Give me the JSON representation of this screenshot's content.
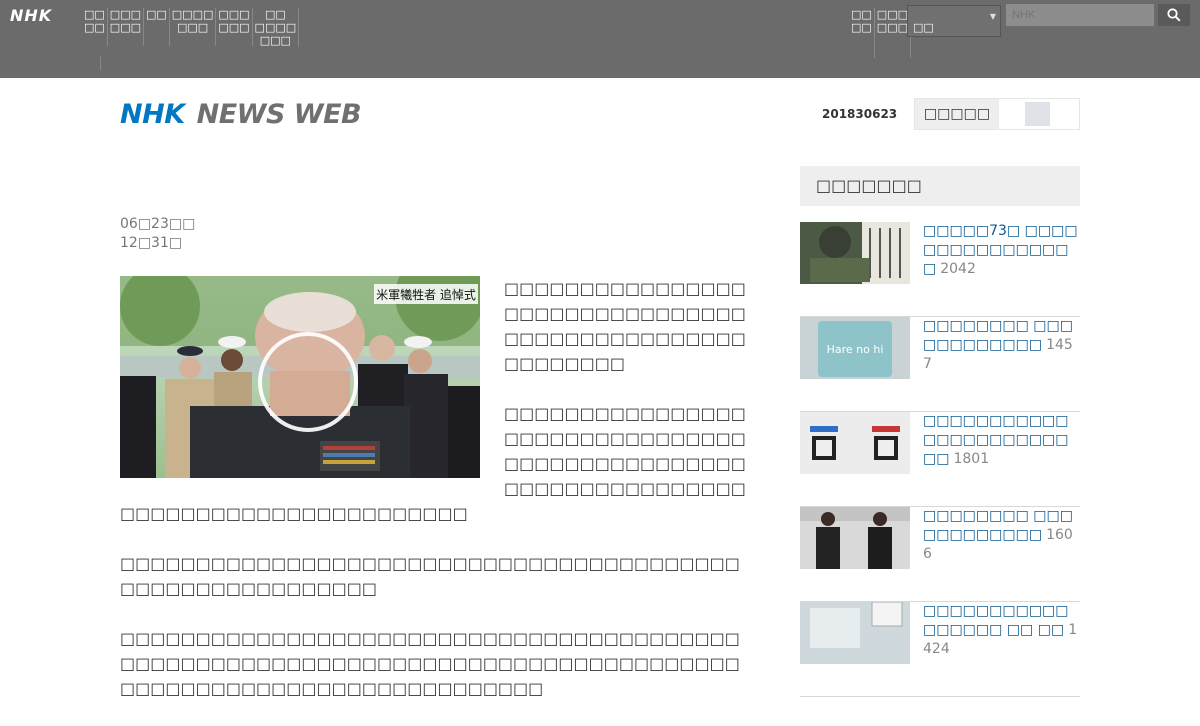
{
  "topbar": {
    "logo": "NHK",
    "nav": [
      "□□\n□□",
      "□□□\n□□□",
      "□□",
      "□□□□\n□□□",
      "□□□\n□□□",
      "□□\n□□□□\n□□□"
    ],
    "right_nav": [
      "□□\n□□",
      "□□□\n□□□"
    ],
    "region_value": "□□",
    "search_placeholder": "NHK",
    "icons": {
      "search": "search-icon",
      "dropdown": "chevron-down-icon"
    }
  },
  "header": {
    "logo_nhk": "NHK",
    "logo_news": "NEWS WEB",
    "date_id": "201830623",
    "toggle_label": "□□□□□"
  },
  "article": {
    "date_line1": "06□23□□",
    "date_line2": "12□31□",
    "photo_caption": "米軍犧牲者 追悼式",
    "paragraphs": [
      "□□□□□□□□□□□□□□□□□□□□□□□□□□□□□□□□□□□□□□□□□□□□□□□□□□□□□□□□",
      "□□□□□□□□□□□□□□□□□□□□□□□□□□□□□□□□□□□□□□□□□□□□□□□□□□□□□□□□□□□□□□□□□□□□□□□□□□□□□□□□□□□□□□□",
      "□□□□□□□□□□□□□□□□□□□□□□□□□□□□□□□□□□□□□□□□□□□□□□□□□□□□□□□□□□",
      "□□□□□□□□□□□□□□□□□□□□□□□□□□□□□□□□□□□□□□□□□□□□□□□□□□□□□□□□□□□□□□□□□□□□□□□□□□□□□□□□□□□□□□□□□□□□□□□□□□□□□□□□□□□□□□"
    ]
  },
  "sidebar": {
    "heading": "□□□□□□□",
    "ranking": [
      {
        "title": "□□□□□73□ □□□□□□□□□□□□□□□□",
        "count": "2042"
      },
      {
        "title": "□□□□□□□□ □□□□□□□□□□□□",
        "count": "1457"
      },
      {
        "title": "□□□□□□□□□□□□□□□□□□□□□□□□",
        "count": "1801"
      },
      {
        "title": "□□□□□□□□ □□□□□□□□□□□□",
        "count": "1606"
      },
      {
        "title": "□□□□□□□□□□□□□□□□□ □□ □□",
        "count": "1424"
      }
    ]
  },
  "colors": {
    "topbar": "#6b6b6b",
    "brand_blue": "#0077c2",
    "link": "#0a5a8f",
    "panel": "#eeeeee"
  }
}
